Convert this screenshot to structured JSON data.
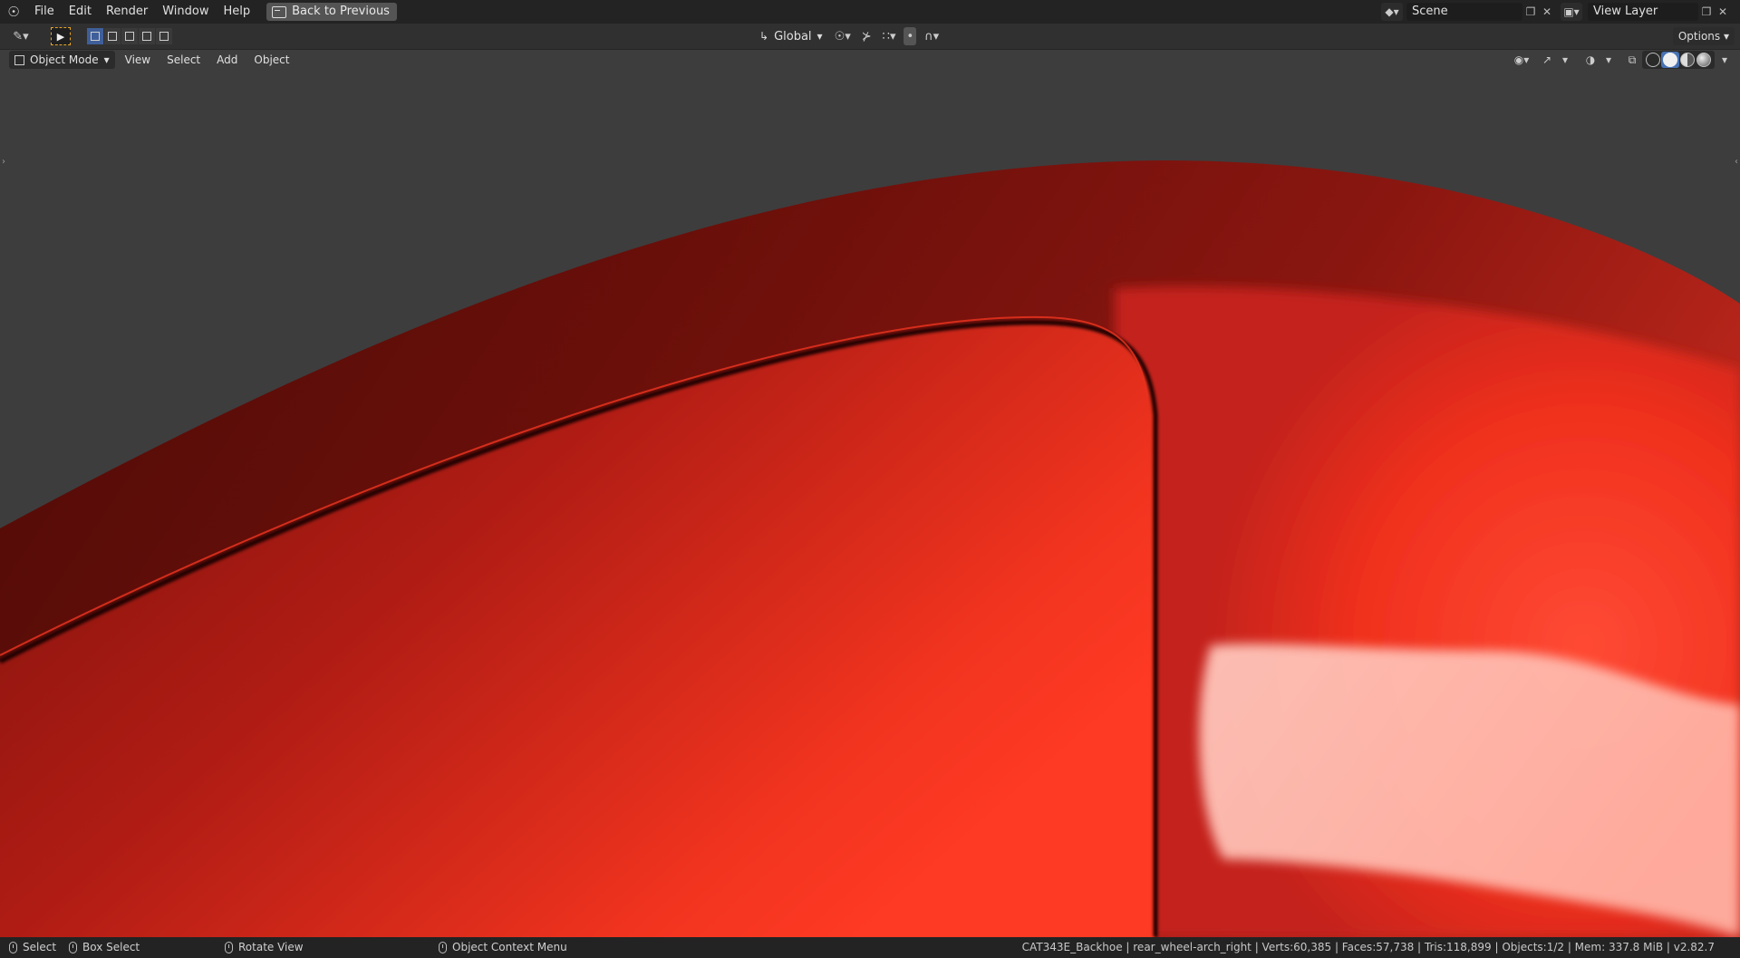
{
  "topbar": {
    "menus": [
      "File",
      "Edit",
      "Render",
      "Window",
      "Help"
    ],
    "back_label": "Back to Previous",
    "scene_value": "Scene",
    "view_layer_value": "View Layer"
  },
  "toolheader": {
    "orientation_label": "Global",
    "options_label": "Options"
  },
  "viewport_header": {
    "mode_label": "Object Mode",
    "menus": [
      "View",
      "Select",
      "Add",
      "Object"
    ]
  },
  "statusbar": {
    "select_label": "Select",
    "box_select_label": "Box Select",
    "rotate_label": "Rotate View",
    "context_label": "Object Context Menu",
    "stats": "CAT343E_Backhoe | rear_wheel-arch_right | Verts:60,385 | Faces:57,738 | Tris:118,899 | Objects:1/2 | Mem: 337.8 MiB | v2.82.7"
  },
  "colors": {
    "body_red": "#e8321f",
    "dark_red": "#5f0e08",
    "highlight": "#ffb8aa",
    "background": "#3d3d3d"
  }
}
